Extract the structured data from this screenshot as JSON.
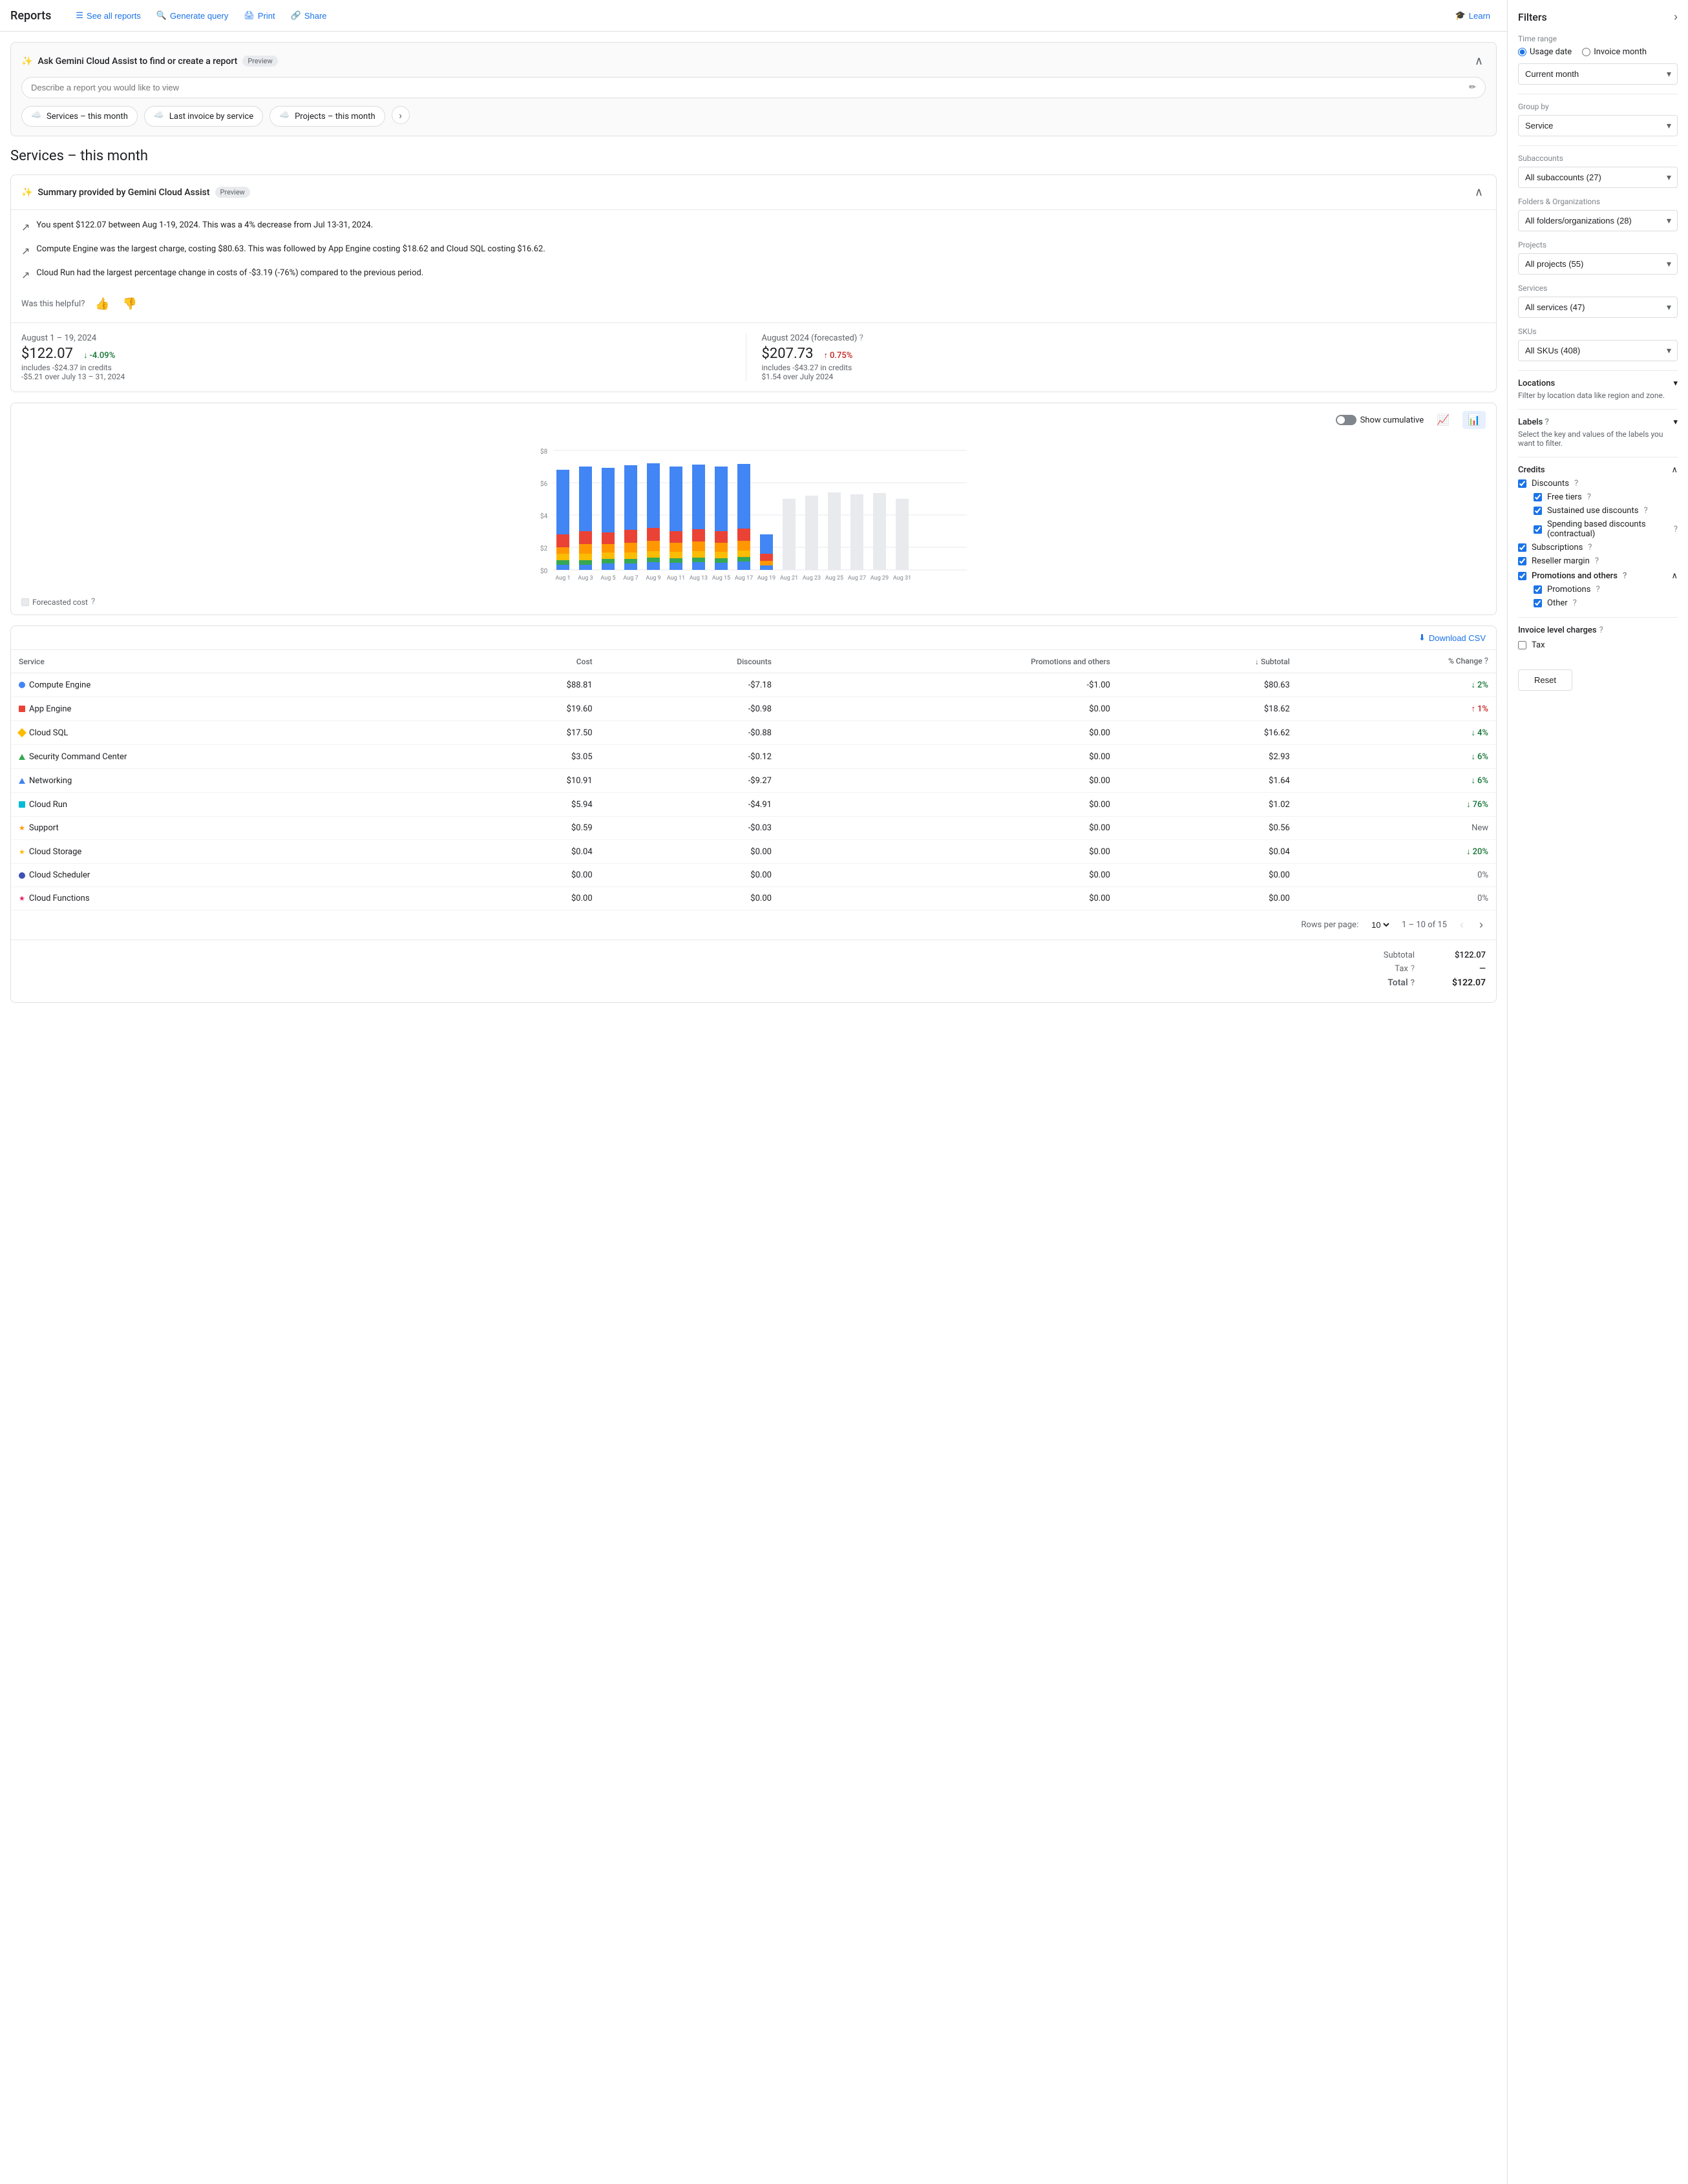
{
  "header": {
    "title": "Reports",
    "nav": [
      {
        "label": "See all reports",
        "icon": "☰"
      },
      {
        "label": "Generate query",
        "icon": "🔍"
      },
      {
        "label": "Print",
        "icon": "🖨"
      },
      {
        "label": "Share",
        "icon": "🔗"
      }
    ],
    "learn_label": "Learn",
    "learn_icon": "🎓"
  },
  "gemini": {
    "title": "Ask Gemini Cloud Assist to find or create a report",
    "badge": "Preview",
    "input_placeholder": "Describe a report you would like to view",
    "chips": [
      {
        "label": "Services – this month",
        "icon": "☁️"
      },
      {
        "label": "Last invoice by service",
        "icon": "☁️"
      },
      {
        "label": "Projects – this month",
        "icon": "☁️"
      }
    ]
  },
  "section_title": "Services – this month",
  "summary": {
    "title": "Summary provided by Gemini Cloud Assist",
    "badge": "Preview",
    "items": [
      "You spent $122.07 between Aug 1-19, 2024. This was a 4% decrease from Jul 13-31, 2024.",
      "Compute Engine was the largest charge, costing $80.63. This was followed by App Engine costing $18.62 and Cloud SQL costing $16.62.",
      "Cloud Run had the largest percentage change in costs of -$3.19 (-76%) compared to the previous period."
    ],
    "helpful_label": "Was this helpful?"
  },
  "stats": {
    "current": {
      "date": "August 1 – 19, 2024",
      "amount": "$122.07",
      "sub": "includes -$24.37 in credits",
      "change_pct": "-4.09%",
      "change_type": "down",
      "change_sub": "-$5.21 over July 13 – 31, 2024"
    },
    "forecast": {
      "date": "August 2024 (forecasted)",
      "amount": "$207.73",
      "sub": "includes -$43.27 in credits",
      "change_pct": "0.75%",
      "change_type": "up",
      "change_sub": "$1.54 over July 2024"
    }
  },
  "chart": {
    "show_cumulative": "Show cumulative",
    "y_max": "$8",
    "y_labels": [
      "$0",
      "$2",
      "$4",
      "$6",
      "$8"
    ],
    "bars": [
      {
        "label": "Aug 1",
        "blue": 80,
        "orange": 25,
        "red": 12,
        "gold": 8,
        "forecasted": false
      },
      {
        "label": "Aug 3",
        "blue": 82,
        "orange": 26,
        "red": 14,
        "gold": 7,
        "forecasted": false
      },
      {
        "label": "Aug 5",
        "blue": 85,
        "orange": 25,
        "red": 13,
        "gold": 8,
        "forecasted": false
      },
      {
        "label": "Aug 7",
        "blue": 83,
        "orange": 27,
        "red": 12,
        "gold": 7,
        "forecasted": false
      },
      {
        "label": "Aug 9",
        "blue": 86,
        "orange": 26,
        "red": 14,
        "gold": 8,
        "forecasted": false
      },
      {
        "label": "Aug 11",
        "blue": 84,
        "orange": 25,
        "red": 13,
        "gold": 7,
        "forecasted": false
      },
      {
        "label": "Aug 13",
        "blue": 87,
        "orange": 27,
        "red": 14,
        "gold": 8,
        "forecasted": false
      },
      {
        "label": "Aug 15",
        "blue": 85,
        "orange": 26,
        "red": 13,
        "gold": 7,
        "forecasted": false
      },
      {
        "label": "Aug 17",
        "blue": 88,
        "orange": 27,
        "red": 15,
        "gold": 8,
        "forecasted": false
      },
      {
        "label": "Aug 19",
        "blue": 20,
        "orange": 5,
        "red": 3,
        "gold": 2,
        "forecasted": false
      },
      {
        "label": "Aug 21",
        "blue": 0,
        "orange": 0,
        "red": 0,
        "gold": 0,
        "forecasted": true,
        "fcast": 40
      },
      {
        "label": "Aug 23",
        "blue": 0,
        "orange": 0,
        "red": 0,
        "gold": 0,
        "forecasted": true,
        "fcast": 42
      },
      {
        "label": "Aug 25",
        "blue": 0,
        "orange": 0,
        "red": 0,
        "gold": 0,
        "forecasted": true,
        "fcast": 45
      },
      {
        "label": "Aug 27",
        "blue": 0,
        "orange": 0,
        "red": 0,
        "gold": 0,
        "forecasted": true,
        "fcast": 43
      },
      {
        "label": "Aug 29",
        "blue": 0,
        "orange": 0,
        "red": 0,
        "gold": 0,
        "forecasted": true,
        "fcast": 44
      },
      {
        "label": "Aug 31",
        "blue": 0,
        "orange": 0,
        "red": 0,
        "gold": 0,
        "forecasted": true,
        "fcast": 40
      }
    ],
    "legend": [
      {
        "label": "Forecasted cost",
        "color": "#e8eaed"
      }
    ]
  },
  "table": {
    "download_label": "Download CSV",
    "columns": [
      "Service",
      "Cost",
      "Discounts",
      "Promotions and others",
      "↓ Subtotal",
      "% Change"
    ],
    "rows": [
      {
        "service": "Compute Engine",
        "color": "#4285f4",
        "shape": "circle",
        "cost": "$88.81",
        "discounts": "-$7.18",
        "promotions": "-$1.00",
        "subtotal": "$80.63",
        "change_pct": "2%",
        "change_dir": "down"
      },
      {
        "service": "App Engine",
        "color": "#ea4335",
        "shape": "square",
        "cost": "$19.60",
        "discounts": "-$0.98",
        "promotions": "$0.00",
        "subtotal": "$18.62",
        "change_pct": "1%",
        "change_dir": "up"
      },
      {
        "service": "Cloud SQL",
        "color": "#fbbc04",
        "shape": "diamond",
        "cost": "$17.50",
        "discounts": "-$0.88",
        "promotions": "$0.00",
        "subtotal": "$16.62",
        "change_pct": "4%",
        "change_dir": "down"
      },
      {
        "service": "Security Command Center",
        "color": "#34a853",
        "shape": "triangle",
        "cost": "$3.05",
        "discounts": "-$0.12",
        "promotions": "$0.00",
        "subtotal": "$2.93",
        "change_pct": "6%",
        "change_dir": "down"
      },
      {
        "service": "Networking",
        "color": "#4285f4",
        "shape": "triangle",
        "cost": "$10.91",
        "discounts": "-$9.27",
        "promotions": "$0.00",
        "subtotal": "$1.64",
        "change_pct": "6%",
        "change_dir": "down"
      },
      {
        "service": "Cloud Run",
        "color": "#00bcd4",
        "shape": "square",
        "cost": "$5.94",
        "discounts": "-$4.91",
        "promotions": "$0.00",
        "subtotal": "$1.02",
        "change_pct": "76%",
        "change_dir": "down"
      },
      {
        "service": "Support",
        "color": "#ff9800",
        "shape": "star",
        "cost": "$0.59",
        "discounts": "-$0.03",
        "promotions": "$0.00",
        "subtotal": "$0.56",
        "change_pct": "New",
        "change_dir": "neutral"
      },
      {
        "service": "Cloud Storage",
        "color": "#fbbc04",
        "shape": "star",
        "cost": "$0.04",
        "discounts": "$0.00",
        "promotions": "$0.00",
        "subtotal": "$0.04",
        "change_pct": "20%",
        "change_dir": "down"
      },
      {
        "service": "Cloud Scheduler",
        "color": "#3f51b5",
        "shape": "circle",
        "cost": "$0.00",
        "discounts": "$0.00",
        "promotions": "$0.00",
        "subtotal": "$0.00",
        "change_pct": "0%",
        "change_dir": "neutral"
      },
      {
        "service": "Cloud Functions",
        "color": "#e91e63",
        "shape": "star",
        "cost": "$0.00",
        "discounts": "$0.00",
        "promotions": "$0.00",
        "subtotal": "$0.00",
        "change_pct": "0%",
        "change_dir": "neutral"
      }
    ],
    "pagination": {
      "rows_per_page_label": "Rows per page:",
      "rows_per_page": "10",
      "range": "1 – 10 of 15"
    },
    "footer": {
      "subtotal_label": "Subtotal",
      "subtotal_value": "$122.07",
      "tax_label": "Tax",
      "tax_value": "—",
      "total_label": "Total",
      "total_value": "$122.07"
    }
  },
  "filters": {
    "title": "Filters",
    "time_range_label": "Time range",
    "usage_date_label": "Usage date",
    "invoice_month_label": "Invoice month",
    "current_month_label": "Current month",
    "group_by_label": "Group by",
    "group_by_value": "Service",
    "subaccounts_label": "Subaccounts",
    "subaccounts_value": "All subaccounts (27)",
    "folders_label": "Folders & Organizations",
    "folders_value": "All folders/organizations (28)",
    "projects_label": "Projects",
    "projects_value": "All projects (55)",
    "services_label": "Services",
    "services_value": "All services (47)",
    "skus_label": "SKUs",
    "skus_value": "All SKUs (408)",
    "locations_label": "Locations",
    "locations_sub": "Filter by location data like region and zone.",
    "labels_label": "Labels",
    "labels_sub": "Select the key and values of the labels you want to filter.",
    "credits_label": "Credits",
    "discounts_label": "Discounts",
    "free_tiers_label": "Free tiers",
    "sustained_label": "Sustained use discounts",
    "spending_label": "Spending based discounts (contractual)",
    "subscriptions_label": "Subscriptions",
    "reseller_label": "Reseller margin",
    "promotions_label": "Promotions and others",
    "promotions_sub_label": "Promotions",
    "other_label": "Other",
    "invoice_charges_label": "Invoice level charges",
    "tax_label": "Tax",
    "reset_label": "Reset"
  }
}
